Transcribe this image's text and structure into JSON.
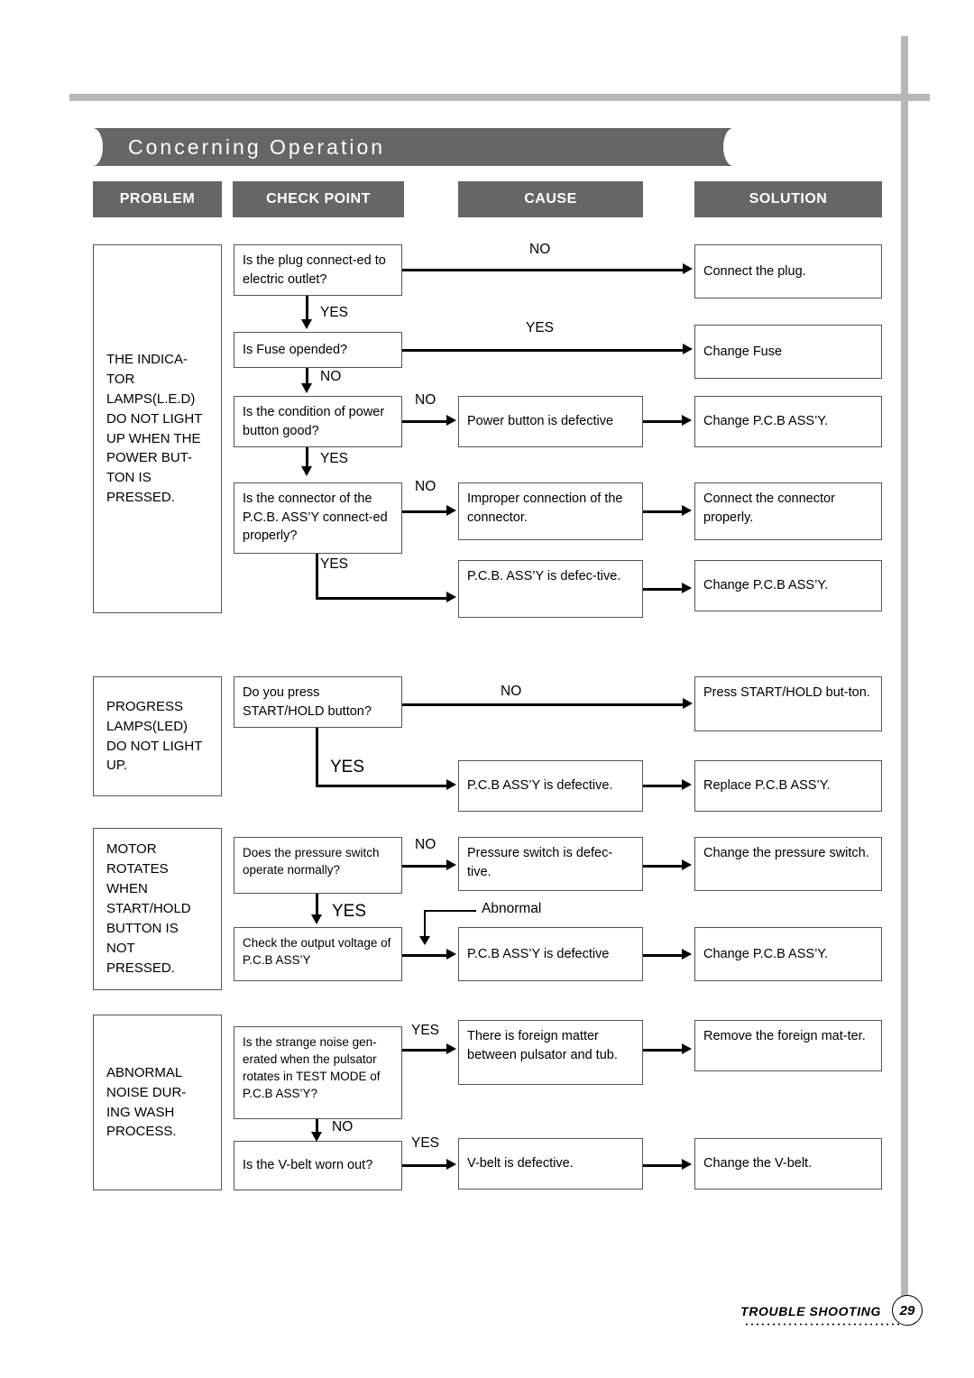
{
  "page": {
    "title": "Concerning Operation",
    "footer_label": "TROUBLE SHOOTING",
    "page_number": "29",
    "accent_gray": "#666666",
    "rule_gray": "#b7b7b7"
  },
  "columns": [
    {
      "label": "PROBLEM"
    },
    {
      "label": "CHECK POINT"
    },
    {
      "label": "CAUSE"
    },
    {
      "label": "SOLUTION"
    }
  ],
  "sections": [
    {
      "problem": "THE INDICA-\nTOR\nLAMPS(L.E.D)\nDO NOT LIGHT\nUP WHEN THE\nPOWER BUT-\nTON IS\nPRESSED.",
      "checks": [
        "Is the plug connect-ed to electric outlet?",
        "Is Fuse opended?",
        "Is the condition of power button good?",
        "Is the connector of the P.C.B. ASS’Y connect-ed properly?"
      ],
      "causes": [
        "Power button is defective",
        "Improper connection of the connector.",
        "P.C.B. ASS’Y is defec-tive."
      ],
      "solutions": [
        "Connect the plug.",
        "Change Fuse",
        "Change P.C.B ASS’Y.",
        "Connect the connector properly.",
        "Change P.C.B ASS’Y."
      ],
      "labels": {
        "l1": "NO",
        "l2": "YES",
        "l3": "YES",
        "l4": "NO",
        "l5": "NO",
        "l6": "YES",
        "l7": "NO",
        "l8": "YES"
      }
    },
    {
      "problem": "PROGRESS\nLAMPS(LED)\nDO NOT LIGHT\nUP.",
      "checks": [
        "Do you press START/HOLD button?"
      ],
      "causes": [
        "P.C.B ASS’Y is defective."
      ],
      "solutions": [
        "Press START/HOLD but-ton.",
        "Replace P.C.B ASS’Y."
      ],
      "labels": {
        "l1": "NO",
        "l2": "YES"
      }
    },
    {
      "problem": "MOTOR\nROTATES\nWHEN\nSTART/HOLD\nBUTTON IS\nNOT\nPRESSED.",
      "checks": [
        "Does the pressure switch operate normally?",
        "Check the output voltage of P.C.B ASS’Y"
      ],
      "causes": [
        "Pressure switch is defec-tive.",
        "P.C.B ASS’Y is defective"
      ],
      "solutions": [
        "Change the pressure switch.",
        "Change P.C.B ASS’Y."
      ],
      "labels": {
        "l1": "NO",
        "l2": "YES",
        "l3": "Abnormal"
      }
    },
    {
      "problem": "ABNORMAL\nNOISE DUR-\nING WASH\nPROCESS.",
      "checks": [
        "Is the strange noise gen-erated when the pulsator rotates in TEST MODE of P.C.B ASS’Y?",
        "Is the V-belt worn out?"
      ],
      "causes": [
        "There is foreign matter between pulsator and tub.",
        "V-belt is defective."
      ],
      "solutions": [
        "Remove the foreign mat-ter.",
        "Change the V-belt."
      ],
      "labels": {
        "l1": "YES",
        "l2": "NO",
        "l3": "YES"
      }
    }
  ]
}
